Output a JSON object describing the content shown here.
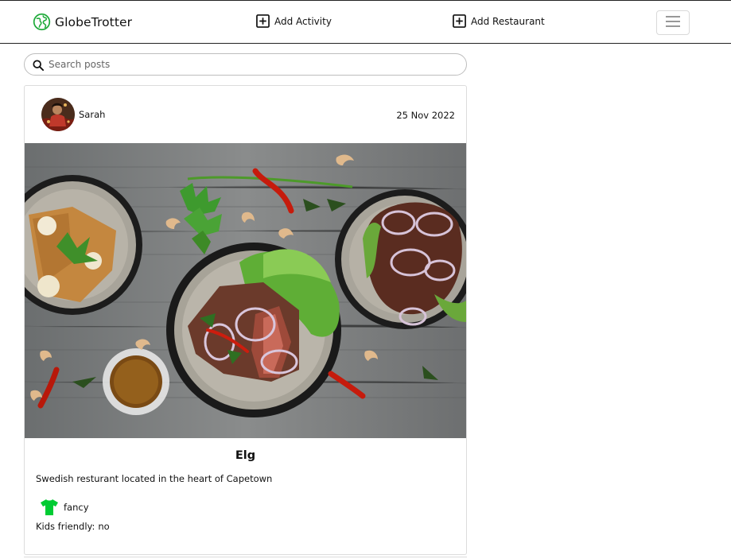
{
  "header": {
    "brand": "GlobeTrotter",
    "nav": {
      "add_activity": "Add Activity",
      "add_restaurant": "Add Restaurant"
    },
    "menu_icon": "hamburger-icon"
  },
  "search": {
    "placeholder": "Search posts",
    "value": ""
  },
  "post": {
    "author": "Sarah",
    "date": "25 Nov 2022",
    "title": "Elg",
    "description": "Swedish resturant located in the heart of Capetown",
    "tag": "fancy",
    "tag_icon": "shirt-icon",
    "tag_color": "#00cc33",
    "kids_label": "Kids friendly:",
    "kids_value": "no"
  }
}
